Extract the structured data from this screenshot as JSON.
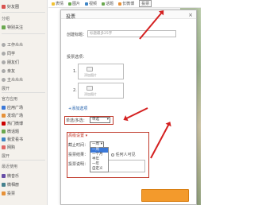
{
  "sidebar": {
    "top": [
      {
        "label": "好友圈",
        "icon": "home-icon",
        "color": "#d9534f"
      }
    ],
    "group_head": "分组",
    "groups": [
      {
        "label": "特别关注",
        "icon": "star-icon",
        "color": "#6aa84f"
      }
    ],
    "groups2": [
      {
        "label": "工作众众",
        "icon": "circle-icon",
        "color": "#999999"
      },
      {
        "label": "同学",
        "icon": "circle-icon",
        "color": "#999999"
      },
      {
        "label": "朋友们",
        "icon": "circle-icon",
        "color": "#999999"
      },
      {
        "label": "亲友",
        "icon": "circle-icon",
        "color": "#999999"
      },
      {
        "label": "主众众众",
        "icon": "circle-icon",
        "color": "#999999"
      }
    ],
    "expand1": "展开",
    "official_head": "官方应用",
    "official": [
      {
        "label": "应用广场",
        "icon": "app-icon",
        "color": "#3b78d8"
      },
      {
        "label": "发现广场",
        "icon": "discover-icon",
        "color": "#e69138"
      },
      {
        "label": "热门微博",
        "icon": "hot-icon",
        "color": "#cc0000"
      },
      {
        "label": "微话题",
        "icon": "topic-icon",
        "color": "#6aa84f"
      },
      {
        "label": "我爱看书",
        "icon": "book-icon",
        "color": "#3d85c6"
      },
      {
        "label": "网购",
        "icon": "shop-icon",
        "color": "#e06666"
      }
    ],
    "expand2": "展开",
    "recent_head": "最近使用",
    "recent": [
      {
        "label": "微音乐",
        "icon": "music-icon",
        "color": "#674ea7"
      },
      {
        "label": "微相册",
        "icon": "album-icon",
        "color": "#45818e"
      },
      {
        "label": "投票",
        "icon": "vote-icon",
        "color": "#e69138"
      }
    ]
  },
  "toolbar": {
    "items": [
      {
        "label": "表情",
        "icon": "emoji-icon",
        "color": "#f1c232"
      },
      {
        "label": "图片",
        "icon": "image-icon",
        "color": "#6aa84f"
      },
      {
        "label": "视频",
        "icon": "video-icon",
        "color": "#3d85c6"
      },
      {
        "label": "话题",
        "icon": "hashtag-icon",
        "color": "#6aa84f"
      },
      {
        "label": "长微博",
        "icon": "longpost-icon",
        "color": "#e69138"
      }
    ],
    "vote": "投票"
  },
  "dialog": {
    "title": "投票",
    "close": "×",
    "title_label": "创建标题：",
    "title_placeholder": "标题最多25字",
    "options_label": "投票选项：",
    "option_numbers": [
      "1.",
      "2."
    ],
    "upload_text": "添加图片",
    "add_option": "+添加选项",
    "single_label": "单选/多选：",
    "single_value": "单选",
    "advanced_label": "高级设置 ▾",
    "deadline_label": "截止时间：",
    "deadline_value": "一周",
    "result_label": "投票结果：",
    "result_option": "任何人可见",
    "desc_label": "投票说明：",
    "deadline_options": [
      "一周",
      "一个月",
      "半年",
      "一年",
      "自定义"
    ]
  }
}
